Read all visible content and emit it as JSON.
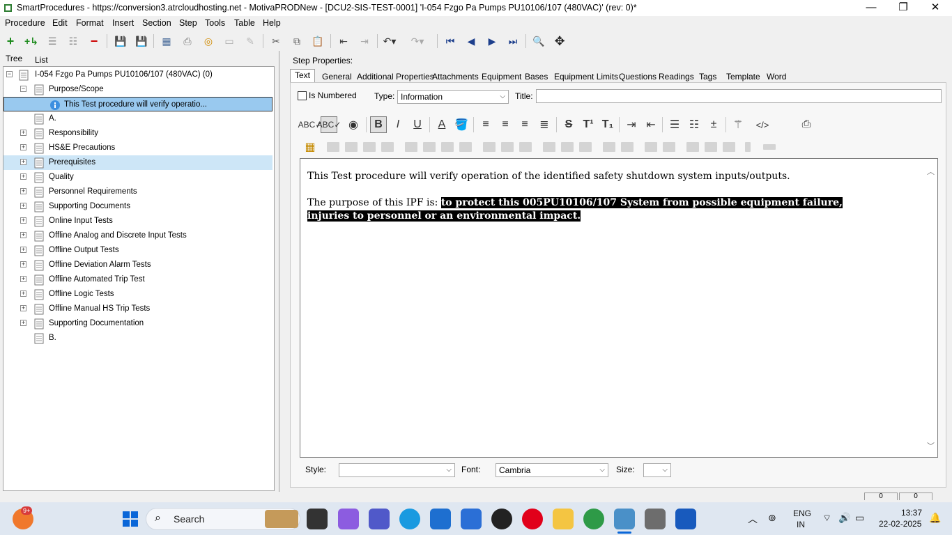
{
  "window": {
    "title": "SmartProcedures - https://conversion3.atrcloudhosting.net - MotivaPRODNew - [DCU2-SIS-TEST-0001] 'I-054 Fzgo Pa Pumps PU10106/107 (480VAC)' (rev: 0)*",
    "minimize": "—",
    "maximize": "❐",
    "close": "✕"
  },
  "menu": [
    "Procedure",
    "Edit",
    "Format",
    "Insert",
    "Section",
    "Step",
    "Tools",
    "Table",
    "Help"
  ],
  "left_tabs": [
    "Tree",
    "List"
  ],
  "tree": {
    "root": "I-054 Fzgo Pa Pumps PU10106/107 (480VAC) (0)",
    "purpose": "Purpose/Scope",
    "info_item": "This Test procedure will verify operatio...",
    "items": [
      "A.",
      "Responsibility",
      "HS&E Precautions",
      "Prerequisites",
      "Quality",
      "Personnel Requirements",
      "Supporting Documents",
      "Online Input Tests",
      "Offline Analog and Discrete Input Tests",
      "Offline Output Tests",
      "Offline Deviation Alarm Tests",
      "Offline Automated Trip Test",
      "Offline Logic Tests",
      "Offline Manual HS Trip Tests",
      "Supporting Documentation",
      "B."
    ]
  },
  "step_properties": {
    "heading": "Step Properties:",
    "tabs": [
      "Text",
      "General",
      "Additional Properties",
      "Attachments",
      "Equipment",
      "Bases",
      "Equipment Limits",
      "Questions",
      "Readings",
      "Tags",
      "Template",
      "Word"
    ],
    "is_numbered_label": "Is Numbered",
    "type_label": "Type:",
    "type_value": "Information",
    "title_label": "Title:",
    "title_value": ""
  },
  "editor": {
    "line1": "This Test procedure will verify operation of the identified safety shutdown system inputs/outputs.",
    "line2_prefix": "The purpose of this IPF is:  ",
    "line2_highlight": "to protect this 005PU10106/107 System from possible equipment failure, injuries to personnel or an environmental impact."
  },
  "format_bar": {
    "style_label": "Style:",
    "style_value": "",
    "font_label": "Font:",
    "font_value": "Cambria",
    "size_label": "Size:",
    "size_value": ""
  },
  "status": {
    "counter1": "0",
    "counter2": "0"
  },
  "taskbar": {
    "search_label": "Search",
    "badge": "9+",
    "lang1": "ENG",
    "lang2": "IN",
    "time": "13:37",
    "date": "22-02-2025"
  }
}
